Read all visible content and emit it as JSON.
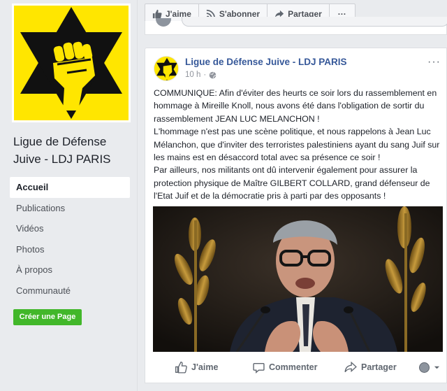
{
  "page": {
    "name": "Ligue de Défense Juive - LDJ PARIS"
  },
  "sidebar": {
    "nav": [
      {
        "label": "Accueil",
        "active": true
      },
      {
        "label": "Publications"
      },
      {
        "label": "Vidéos"
      },
      {
        "label": "Photos"
      },
      {
        "label": "À propos"
      },
      {
        "label": "Communauté"
      }
    ],
    "create_page_label": "Créer une Page"
  },
  "action_bar": {
    "like_label": "J'aime",
    "subscribe_label": "S'abonner",
    "share_label": "Partager",
    "more_label": "···"
  },
  "post": {
    "author": "Ligue de Défense Juive - LDJ PARIS",
    "time": "10 h",
    "paragraphs": [
      "COMMUNIQUE: Afin d'éviter des heurts ce soir lors du rassemblement en hommage à Mireille Knoll, nous avons été dans l'obligation de sortir du rassemblement JEAN LUC MELANCHON !",
      "L'hommage n'est pas une scène politique, et nous rappelons à Jean Luc Mélanchon, que d'inviter des terroristes palestiniens ayant du sang Juif sur les mains est en désaccord total avec sa présence ce soir !",
      "Par ailleurs, nos militants ont dû intervenir également pour assurer la protection physique de Maître GILBERT COLLARD, grand défenseur de l'Etat Juif et de la démocratie pris à parti par des opposants !"
    ],
    "actions": {
      "like": "J'aime",
      "comment": "Commenter",
      "share": "Partager"
    }
  },
  "colors": {
    "brand_yellow": "#ffe600",
    "link_blue": "#365899",
    "green_button": "#42b72a"
  }
}
